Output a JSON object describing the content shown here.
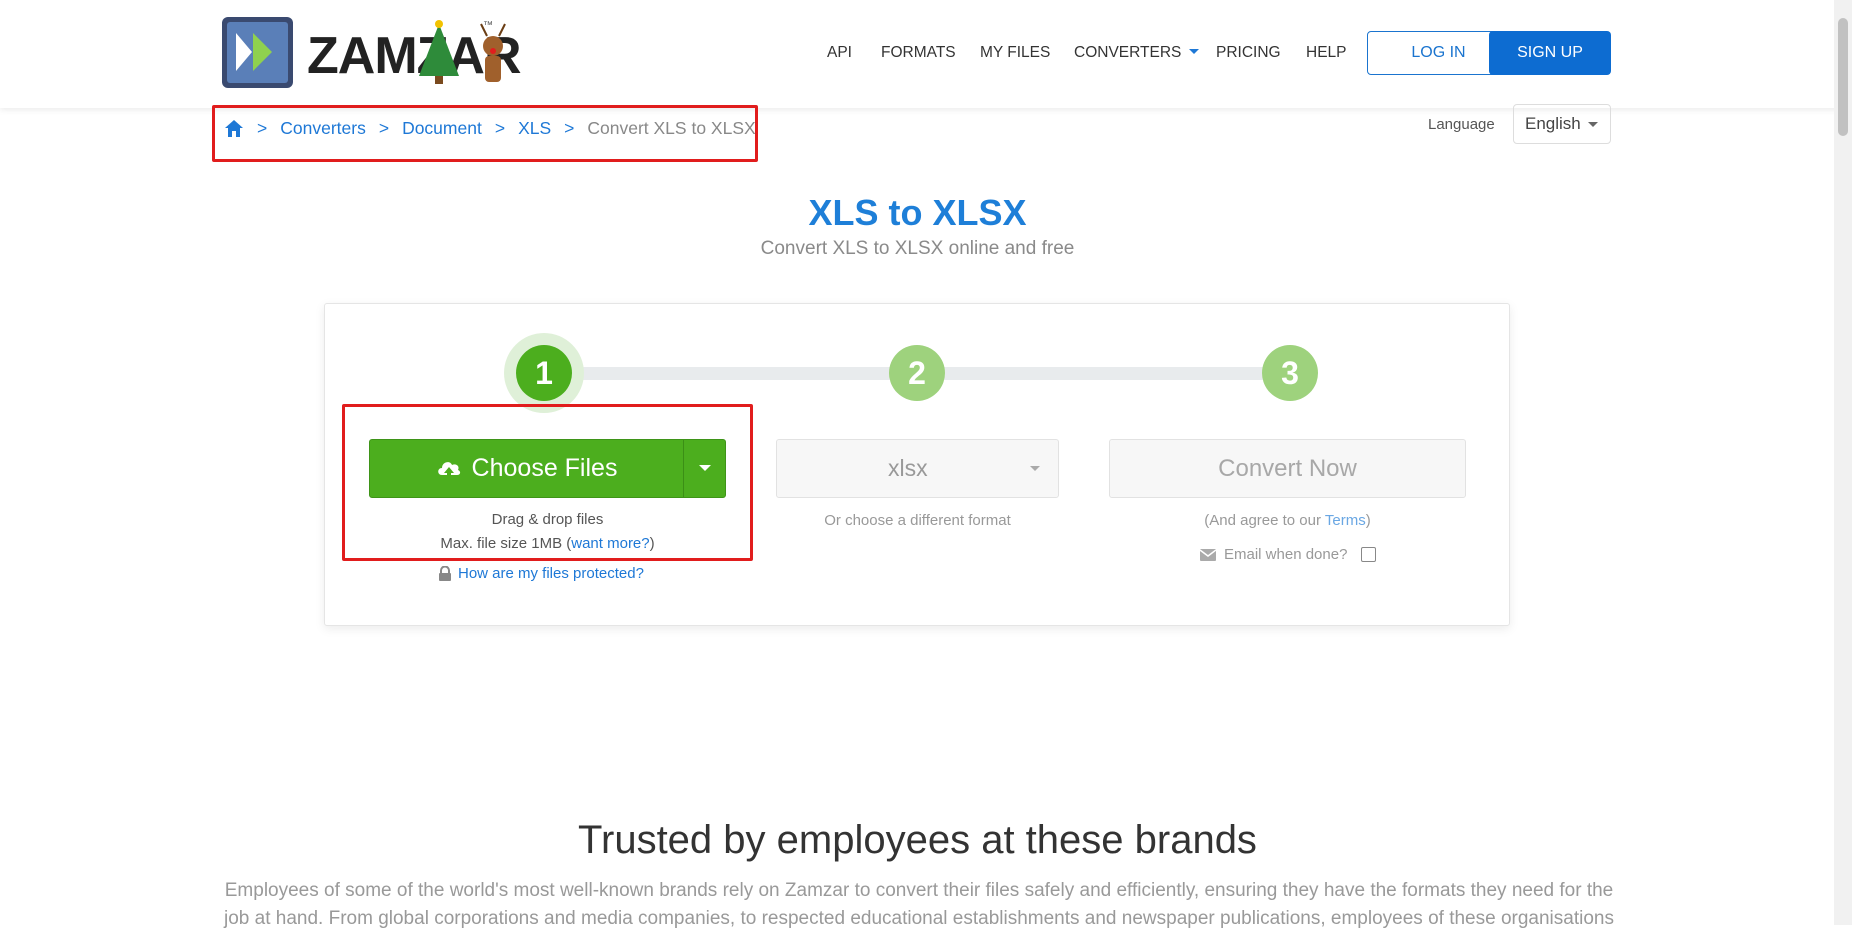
{
  "header": {
    "logo_text": "ZAMZAR",
    "logo_tm": "™",
    "nav": [
      "API",
      "FORMATS",
      "MY FILES",
      "CONVERTERS",
      "PRICING",
      "HELP"
    ],
    "login": "LOG IN",
    "signup": "SIGN UP"
  },
  "breadcrumb": {
    "items": [
      "Converters",
      "Document",
      "XLS"
    ],
    "separator": ">",
    "current": "Convert XLS to XLSX"
  },
  "language": {
    "label": "Language",
    "value": "English"
  },
  "hero": {
    "title": "XLS to XLSX",
    "subtitle": "Convert XLS to XLSX online and free"
  },
  "steps": [
    "1",
    "2",
    "3"
  ],
  "upload": {
    "button": "Choose Files",
    "drag": "Drag & drop files",
    "max_prefix": "Max. file size 1MB (",
    "max_link": "want more?",
    "max_suffix": ")",
    "protected": "How are my files protected?"
  },
  "format": {
    "value": "xlsx",
    "hint": "Or choose a different format"
  },
  "convert": {
    "button": "Convert Now",
    "agree_prefix": "(And agree to our ",
    "agree_link": "Terms",
    "agree_suffix": ")",
    "email": "Email when done?"
  },
  "brands": {
    "title": "Trusted by employees at these brands",
    "text": "Employees of some of the world's most well-known brands rely on Zamzar to convert their files safely and efficiently, ensuring they have the formats they need for the job at hand. From global corporations and media companies, to respected educational establishments and newspaper publications, employees of these organisations"
  },
  "colors": {
    "accent": "#1e78d6",
    "green": "#4cae1e",
    "highlight": "#e11d1d"
  }
}
